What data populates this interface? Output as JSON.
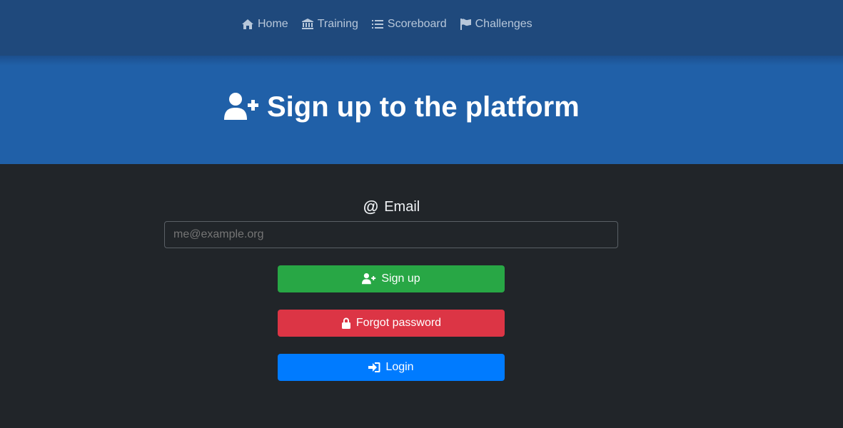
{
  "nav": {
    "items": [
      {
        "label": "Home",
        "icon": "home-icon"
      },
      {
        "label": "Training",
        "icon": "bank-icon"
      },
      {
        "label": "Scoreboard",
        "icon": "list-icon"
      },
      {
        "label": "Challenges",
        "icon": "flag-icon"
      }
    ]
  },
  "hero": {
    "title": "Sign up to the platform",
    "icon": "user-plus-icon"
  },
  "form": {
    "email_icon": "@",
    "email_label": "Email",
    "email_placeholder": "me@example.org",
    "email_value": ""
  },
  "buttons": {
    "signup_label": "Sign up",
    "forgot_label": "Forgot password",
    "login_label": "Login"
  },
  "colors": {
    "navbar": "#1f497c",
    "hero": "#2060a8",
    "background": "#212529",
    "signup": "#28a745",
    "forgot": "#dc3545",
    "login": "#007bff"
  }
}
